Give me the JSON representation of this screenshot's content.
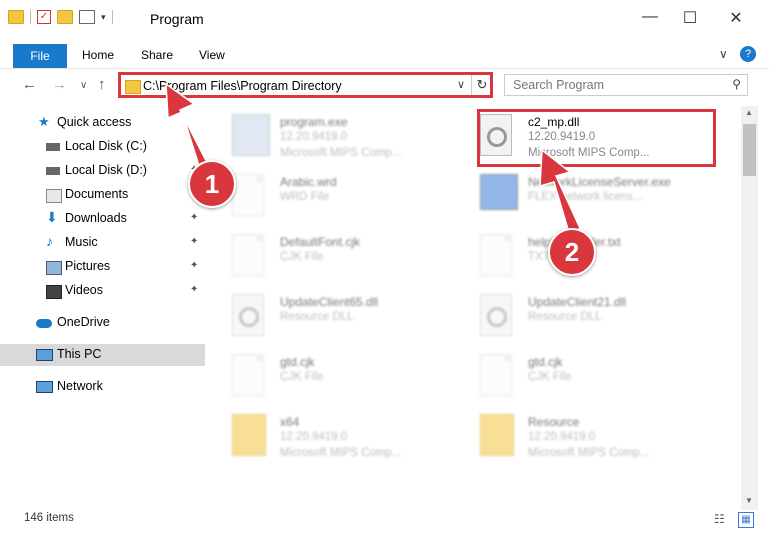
{
  "window": {
    "title": "Program",
    "controls": {
      "minimize": "—",
      "maximize": "☐",
      "close": "✕"
    }
  },
  "ribbon": {
    "file": "File",
    "tabs": [
      "Home",
      "Share",
      "View"
    ],
    "help": "?",
    "expand": "∨"
  },
  "nav": {
    "back": "←",
    "forward": "→",
    "recent": "∨",
    "up": "↑",
    "address": "C:\\Program Files\\Program Directory",
    "address_chevron": "∨",
    "refresh": "↻",
    "search_placeholder": "Search Program",
    "search_icon": "⚲"
  },
  "sidebar": [
    {
      "label": "Quick access",
      "icon": "star-icon",
      "pin": ""
    },
    {
      "label": "Local Disk (C:)",
      "icon": "drive-icon",
      "pin": "✦"
    },
    {
      "label": "Local Disk (D:)",
      "icon": "drive-icon",
      "pin": "✦"
    },
    {
      "label": "Documents",
      "icon": "documents-icon",
      "pin": "✦"
    },
    {
      "label": "Downloads",
      "icon": "downloads-icon",
      "pin": "✦"
    },
    {
      "label": "Music",
      "icon": "music-icon",
      "pin": "✦"
    },
    {
      "label": "Pictures",
      "icon": "pictures-icon",
      "pin": "✦"
    },
    {
      "label": "Videos",
      "icon": "videos-icon",
      "pin": "✦"
    },
    {
      "label": "OneDrive",
      "icon": "cloud-icon",
      "pin": ""
    },
    {
      "label": "This PC",
      "icon": "pc-icon",
      "pin": ""
    },
    {
      "label": "Network",
      "icon": "network-icon",
      "pin": ""
    }
  ],
  "files": [
    {
      "name": "program.exe",
      "line2": "12.20.9419.0",
      "line3": "Microsoft MIPS Comp...",
      "icon": "exe-icon",
      "blurred": true
    },
    {
      "name": "c2_mp.dll",
      "line2": "12.20.9419.0",
      "line3": "Microsoft MIPS Comp...",
      "icon": "dll-gear-icon",
      "blurred": false
    },
    {
      "name": "Arabic.wrd",
      "line2": "WRD File",
      "line3": "",
      "icon": "document-icon",
      "blurred": true
    },
    {
      "name": "NetworkLicenseServer.exe",
      "line2": "FLEX network licens...",
      "line3": "",
      "icon": "monitor-icon",
      "blurred": true
    },
    {
      "name": "DefaultFont.cjk",
      "line2": "CJK File",
      "line3": "",
      "icon": "document-icon",
      "blurred": true
    },
    {
      "name": "helpfileReader.txt",
      "line2": "TXT File",
      "line3": "",
      "icon": "document-icon",
      "blurred": true
    },
    {
      "name": "UpdateClient65.dll",
      "line2": "Resource DLL",
      "line3": "",
      "icon": "dll-gear-icon",
      "blurred": true
    },
    {
      "name": "UpdateClient21.dll",
      "line2": "Resource DLL",
      "line3": "",
      "icon": "dll-gear-icon",
      "blurred": true
    },
    {
      "name": "gtd.cjk",
      "line2": "CJK File",
      "line3": "",
      "icon": "document-icon",
      "blurred": true
    },
    {
      "name": "gtd.cjk",
      "line2": "CJK File",
      "line3": "",
      "icon": "document-icon",
      "blurred": true
    },
    {
      "name": "x64",
      "line2": "12.20.9419.0",
      "line3": "Microsoft MIPS Comp...",
      "icon": "folder-icon",
      "blurred": true
    },
    {
      "name": "Resource",
      "line2": "12.20.9419.0",
      "line3": "Microsoft MIPS Comp...",
      "icon": "folder-icon",
      "blurred": true
    }
  ],
  "status": {
    "items": "146 items"
  },
  "callouts": [
    "1",
    "2"
  ],
  "colors": {
    "accent": "#1979ca",
    "highlight": "#d9363e"
  }
}
